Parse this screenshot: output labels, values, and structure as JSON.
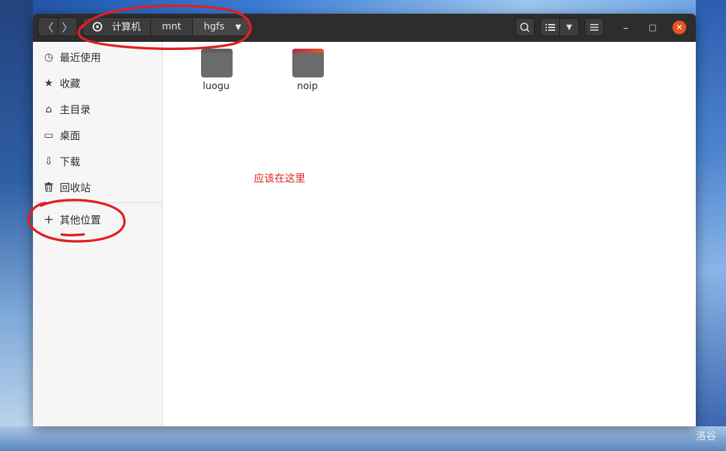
{
  "window": {
    "path_crumbs": [
      {
        "label": "计算机",
        "icon": "disk-icon"
      },
      {
        "label": "mnt"
      },
      {
        "label": "hgfs"
      }
    ],
    "nav": {
      "back": "〈",
      "forward": "〉"
    },
    "toolbar": {
      "search_icon": "search-icon",
      "view_icon": "list-view-icon",
      "menu_icon": "hamburger-menu-icon"
    },
    "controls": {
      "minimize": "–",
      "maximize": "□",
      "close": "✕"
    }
  },
  "sidebar": {
    "items": [
      {
        "label": "最近使用",
        "icon": "clock-icon",
        "glyph": "◷"
      },
      {
        "label": "收藏",
        "icon": "star-icon",
        "glyph": "★"
      },
      {
        "label": "主目录",
        "icon": "home-icon",
        "glyph": "⌂"
      },
      {
        "label": "桌面",
        "icon": "desktop-icon",
        "glyph": "▭"
      },
      {
        "label": "下载",
        "icon": "download-icon",
        "glyph": "⇩"
      },
      {
        "label": "回收站",
        "icon": "trash-icon",
        "glyph": "🗑"
      },
      {
        "label": "其他位置",
        "icon": "plus-icon",
        "glyph": "+"
      }
    ]
  },
  "files": [
    {
      "name": "luogu",
      "tab_color": "#6b6b6b"
    },
    {
      "name": "noip",
      "tab_color": "#e95420"
    }
  ],
  "annotation": {
    "text": "应该在这里",
    "color": "#e02020"
  },
  "watermark": {
    "text": "洛谷"
  },
  "colors": {
    "accent": "#e95420",
    "headerbar": "#2d2d2d",
    "annotation": "#e02020"
  }
}
